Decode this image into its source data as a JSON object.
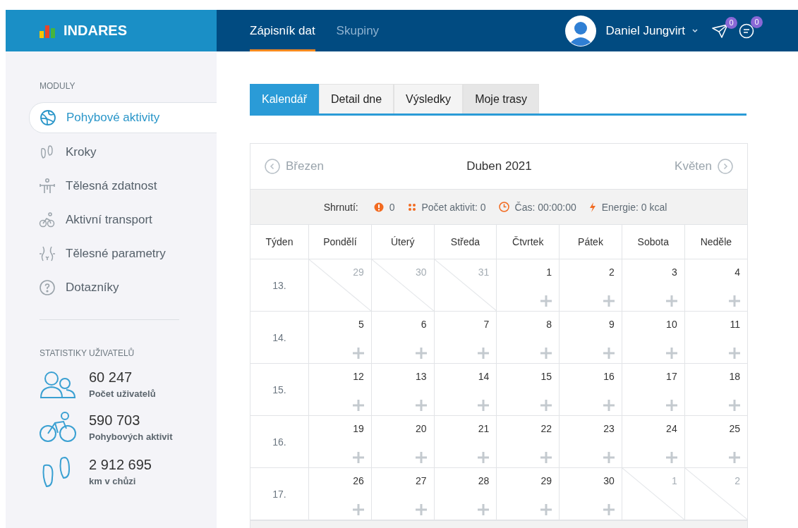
{
  "header": {
    "logo": "INDARES",
    "nav": [
      {
        "label": "Zápisník dat",
        "selected": true
      },
      {
        "label": "Skupiny",
        "selected": false
      }
    ],
    "user": "Daniel Jungvirt",
    "badges": [
      {
        "kind": "send",
        "count": "0"
      },
      {
        "kind": "messages",
        "count": "0"
      }
    ]
  },
  "sidebar": {
    "modules_title": "MODULY",
    "items": [
      {
        "label": "Pohybové aktivity",
        "selected": true
      },
      {
        "label": "Kroky",
        "selected": false
      },
      {
        "label": "Tělesná zdatnost",
        "selected": false
      },
      {
        "label": "Aktivní transport",
        "selected": false
      },
      {
        "label": "Tělesné parametry",
        "selected": false
      },
      {
        "label": "Dotazníky",
        "selected": false
      }
    ],
    "stats_title": "STATISTIKY UŽIVATELŮ",
    "stats": [
      {
        "value": "60 247",
        "label": "Počet uživatelů"
      },
      {
        "value": "590 703",
        "label": "Pohybových aktivit"
      },
      {
        "value": "2 912 695",
        "label": "km v chůzi"
      }
    ]
  },
  "tabs": [
    {
      "label": "Kalendář",
      "selected": true
    },
    {
      "label": "Detail dne",
      "selected": false
    },
    {
      "label": "Výsledky",
      "selected": false
    },
    {
      "label": "Moje trasy",
      "selected": false
    }
  ],
  "calendar": {
    "prev": "Březen",
    "title": "Duben 2021",
    "next": "Květen",
    "summary": {
      "label": "Shrnutí:",
      "warnings": "0",
      "activities": "Počet aktivit: 0",
      "time": "Čas: 00:00:00",
      "energy": "Energie: 0 kcal"
    },
    "columns": [
      "Týden",
      "Pondělí",
      "Úterý",
      "Středa",
      "Čtvrtek",
      "Pátek",
      "Sobota",
      "Neděle"
    ],
    "weeks": [
      {
        "week": "13.",
        "days": [
          {
            "day": "29",
            "outside": true
          },
          {
            "day": "30",
            "outside": true
          },
          {
            "day": "31",
            "outside": true
          },
          {
            "day": "1",
            "outside": false
          },
          {
            "day": "2",
            "outside": false
          },
          {
            "day": "3",
            "outside": false
          },
          {
            "day": "4",
            "outside": false
          }
        ]
      },
      {
        "week": "14.",
        "days": [
          {
            "day": "5",
            "outside": false
          },
          {
            "day": "6",
            "outside": false
          },
          {
            "day": "7",
            "outside": false
          },
          {
            "day": "8",
            "outside": false
          },
          {
            "day": "9",
            "outside": false
          },
          {
            "day": "10",
            "outside": false
          },
          {
            "day": "11",
            "outside": false
          }
        ]
      },
      {
        "week": "15.",
        "days": [
          {
            "day": "12",
            "outside": false
          },
          {
            "day": "13",
            "outside": false
          },
          {
            "day": "14",
            "outside": false
          },
          {
            "day": "15",
            "outside": false
          },
          {
            "day": "16",
            "outside": false
          },
          {
            "day": "17",
            "outside": false
          },
          {
            "day": "18",
            "outside": false
          }
        ]
      },
      {
        "week": "16.",
        "days": [
          {
            "day": "19",
            "outside": false
          },
          {
            "day": "20",
            "outside": false
          },
          {
            "day": "21",
            "outside": false
          },
          {
            "day": "22",
            "outside": false
          },
          {
            "day": "23",
            "outside": false
          },
          {
            "day": "24",
            "outside": false
          },
          {
            "day": "25",
            "outside": false
          }
        ]
      },
      {
        "week": "17.",
        "days": [
          {
            "day": "26",
            "outside": false
          },
          {
            "day": "27",
            "outside": false
          },
          {
            "day": "28",
            "outside": false
          },
          {
            "day": "29",
            "outside": false
          },
          {
            "day": "30",
            "outside": false
          },
          {
            "day": "1",
            "outside": true
          },
          {
            "day": "2",
            "outside": true
          }
        ]
      }
    ]
  }
}
